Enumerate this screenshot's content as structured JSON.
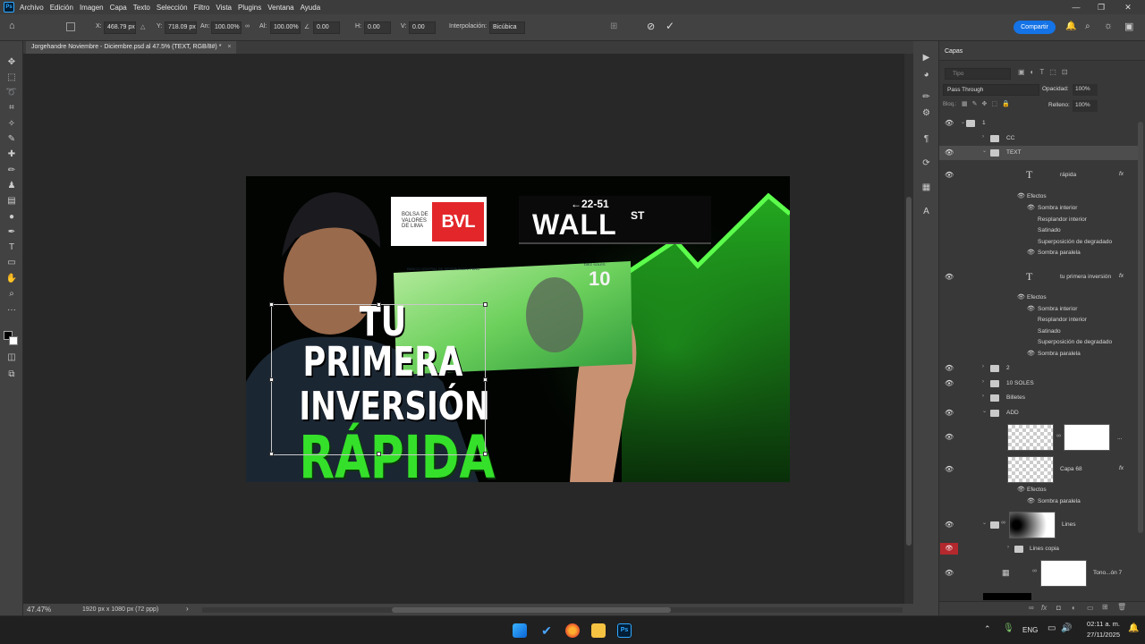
{
  "menu": {
    "app_icon": "Ps",
    "items": [
      "Archivo",
      "Edición",
      "Imagen",
      "Capa",
      "Texto",
      "Selección",
      "Filtro",
      "Vista",
      "Plugins",
      "Ventana",
      "Ayuda"
    ]
  },
  "window_controls": {
    "minimize": "—",
    "restore": "❐",
    "close": "✕"
  },
  "options": {
    "x_label": "X:",
    "x_value": "468.79 px",
    "y_label": "Y:",
    "y_value": "718.09 px",
    "w_label": "An:",
    "w_value": "100.00%",
    "h_label": "Al:",
    "h_value": "100.00%",
    "angle_value": "0.00",
    "hskew_label": "H:",
    "hskew_value": "0.00",
    "vskew_label": "V:",
    "vskew_value": "0.00",
    "interp_label": "Interpolación:",
    "interp_value": "Bicúbica",
    "share_label": "Compartir"
  },
  "document": {
    "tab_title": "Jorgehandre Noviembre - Diciembre.psd al 47.5% (TEXT, RGB/8#) *",
    "tab_close": "×"
  },
  "status": {
    "zoom": "47.47%",
    "doc_info": "1920 px x 1080 px (72 ppp)",
    "arrow": "›"
  },
  "artwork": {
    "logo_line1": "BOLSA DE",
    "logo_line2": "VALORES",
    "logo_line3": "DE LIMA",
    "logo_brand": "BVL",
    "ticker": "←22-51",
    "wall": "WALL",
    "wall_st": "ST",
    "title_line1": "TU PRIMERA",
    "title_line2": "INVERSIÓN",
    "title_line3": "RÁPIDA",
    "bill_text": "BANCO CENTRAL DE RESERVA DEL PERÚ",
    "bill_value": "10",
    "bill_words": "DIEZ SOLES"
  },
  "layers": {
    "panel_title": "Capas",
    "search_placeholder": "Tipo",
    "blend_mode": "Pass Through",
    "opacity_label": "Opacidad:",
    "opacity_value": "100%",
    "lock_label": "Bloq.:",
    "fill_label": "Relleno:",
    "fill_value": "100%",
    "rows": {
      "g1": "1",
      "cc": "CC",
      "text": "TEXT",
      "rapida": "rápida",
      "rapida_fx": "fx",
      "rapida_effects": "Efectos",
      "rapida_e1": "Sombra interior",
      "rapida_e2": "Resplandor interior",
      "rapida_e3": "Satinado",
      "rapida_e4": "Superposición de degradado",
      "rapida_e5": "Sombra paralela",
      "primera": "tu primera inversión",
      "primera_fx": "fx",
      "primera_effects": "Efectos",
      "primera_e1": "Sombra interior",
      "primera_e2": "Resplandor interior",
      "primera_e3": "Satinado",
      "primera_e4": "Superposición de degradado",
      "primera_e5": "Sombra paralela",
      "g2": "2",
      "soles": "10 SOLES",
      "billetes": "Billetes",
      "add": "ADD",
      "add_dots": "...",
      "capa68": "Capa 68",
      "capa68_fx": "fx",
      "capa68_effects": "Efectos",
      "capa68_e1": "Sombra paralela",
      "lines": "Lines",
      "lines_copia": "Lines copia",
      "tono": "Tono...ón 7"
    }
  },
  "taskbar": {
    "lang": "ENG",
    "time": "02:11 a. m.",
    "date": "27/11/2025"
  },
  "colors": {
    "accent": "#1473e6",
    "green": "#35e02a",
    "bvl_red": "#e3262a"
  }
}
